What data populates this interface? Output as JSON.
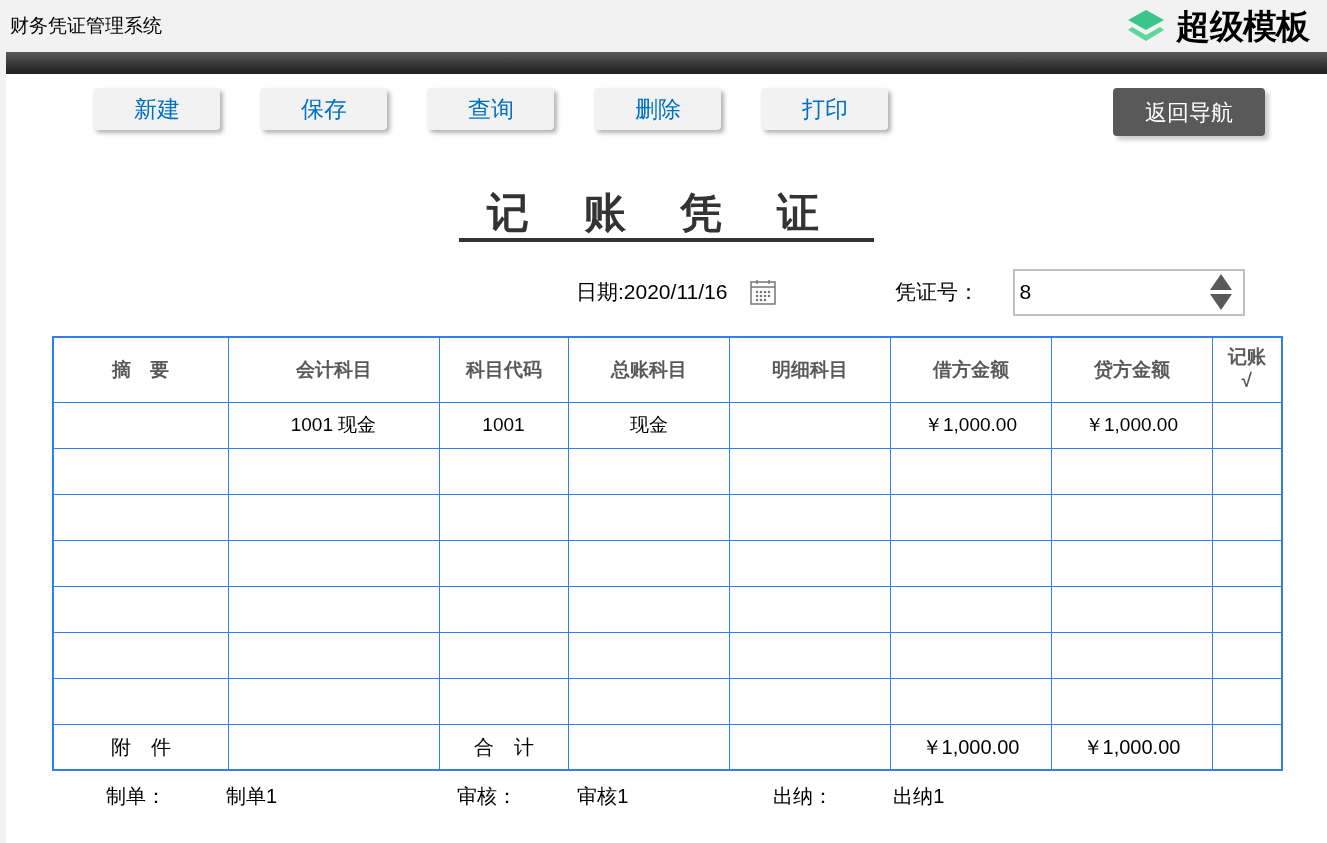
{
  "app": {
    "title": "财务凭证管理系统",
    "logo": "超级模板"
  },
  "toolbar": {
    "buttons": [
      "新建",
      "保存",
      "查询",
      "删除",
      "打印"
    ],
    "nav_button": "返回导航"
  },
  "voucher": {
    "title": "记账凭证",
    "date": "日期:2020/11/16",
    "number_label": "凭证号：",
    "number": "8"
  },
  "table": {
    "columns": [
      "摘　要",
      "会计科目",
      "科目代码",
      "总账科目",
      "明细科目",
      "借方金额",
      "贷方金额",
      "记账√"
    ],
    "rows": [
      {
        "cells": [
          null,
          "1001 现金",
          "1001",
          "现金",
          null,
          "￥1,000.00",
          "￥1,000.00",
          null
        ]
      },
      {},
      {},
      {},
      {},
      {},
      {}
    ],
    "totals": {
      "cells": [
        "附　件",
        null,
        "合　计",
        null,
        null,
        "￥1,000.00",
        "￥1,000.00",
        null
      ]
    }
  },
  "signatures": [
    {
      "label": "制单：",
      "value": "制单1"
    },
    {
      "label": "审核：",
      "value": "审核1"
    },
    {
      "label": "出纳：",
      "value": "出纳1"
    }
  ]
}
